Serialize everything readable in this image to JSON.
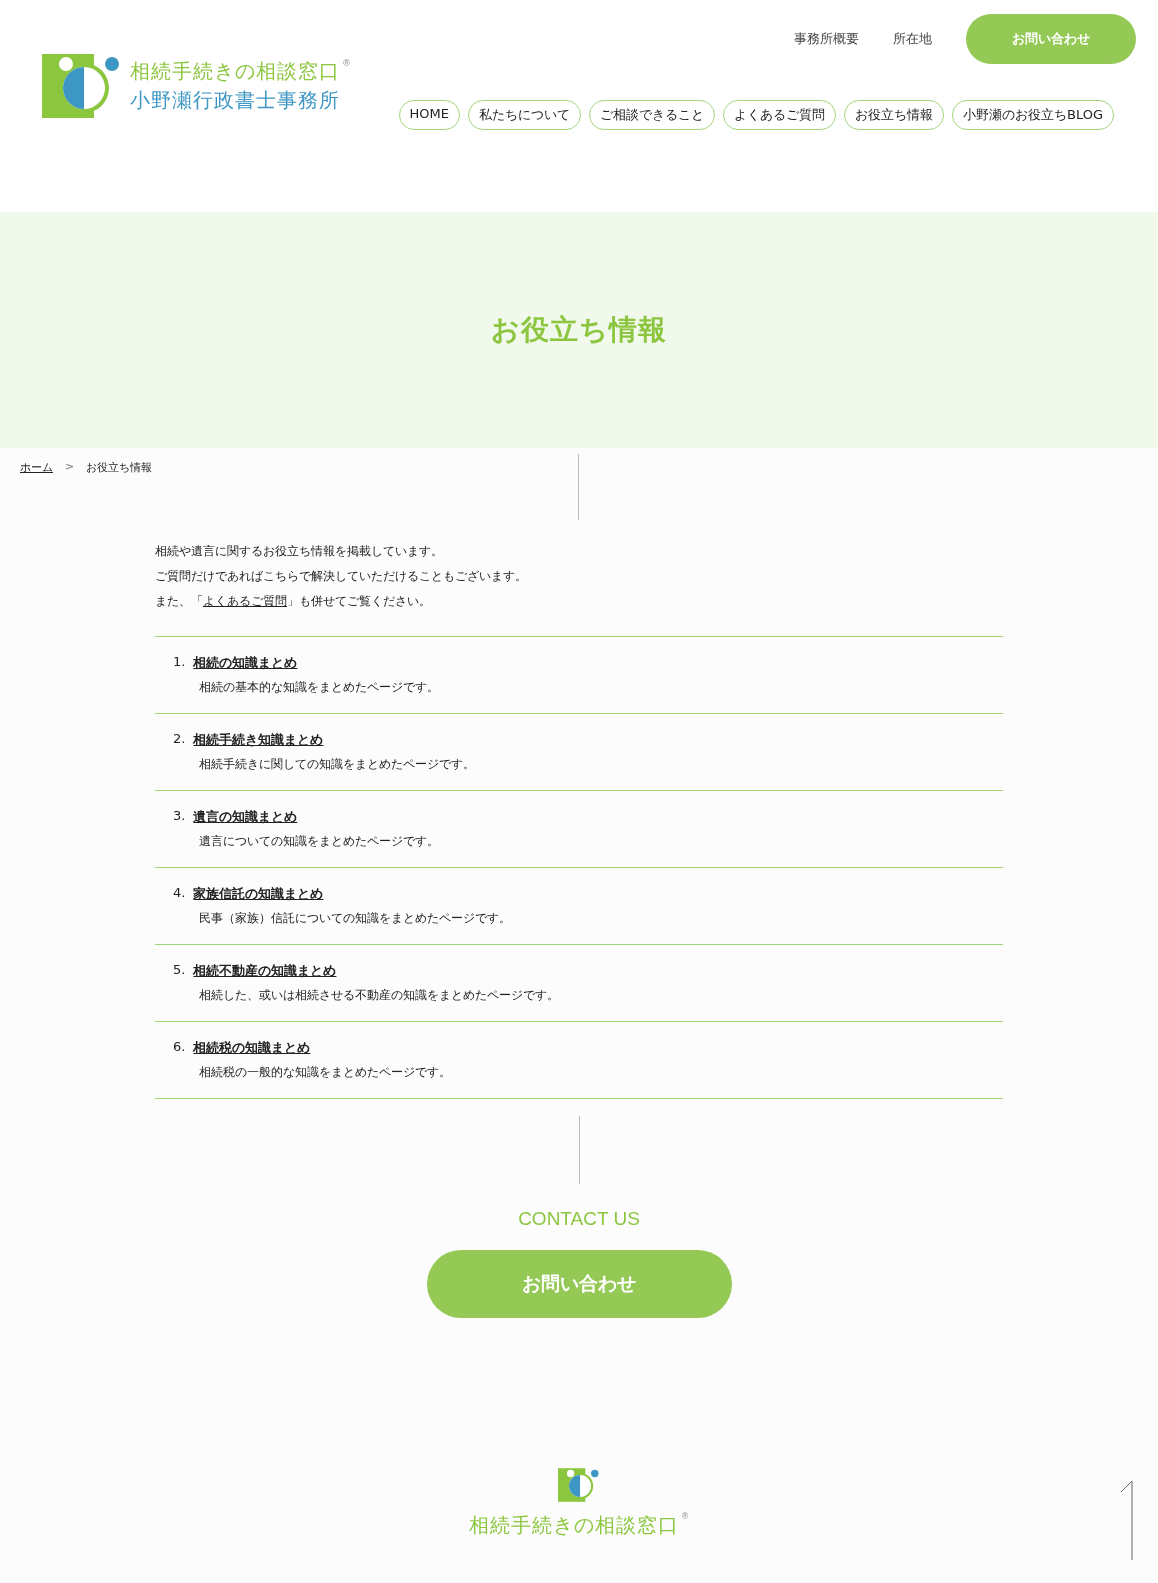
{
  "header": {
    "logo": {
      "line1": "相続手続きの相談窓口",
      "registered": "®",
      "line2": "小野瀬行政書士事務所"
    },
    "top_links": [
      "事務所概要",
      "所在地"
    ],
    "contact_button": "お問い合わせ",
    "nav": [
      "HOME",
      "私たちについて",
      "ご相談できること",
      "よくあるご質問",
      "お役立ち情報",
      "小野瀬のお役立ちBLOG"
    ]
  },
  "hero": {
    "title": "お役立ち情報"
  },
  "breadcrumb": {
    "home": "ホーム",
    "separator": ">",
    "current": "お役立ち情報"
  },
  "intro": {
    "lines": [
      "相続や遺言に関するお役立ち情報を掲載しています。",
      "ご質問だけであればこちらで解決していただけることもございます。"
    ],
    "last": {
      "before": "また、「",
      "link": "よくあるご質問",
      "after": "」も併せてご覧ください。"
    }
  },
  "items": [
    {
      "number": "1.",
      "title": "相続の知識まとめ",
      "description": "相続の基本的な知識をまとめたページです。"
    },
    {
      "number": "2.",
      "title": "相続手続き知識まとめ",
      "description": "相続手続きに関しての知識をまとめたページです。"
    },
    {
      "number": "3.",
      "title": "遺言の知識まとめ",
      "description": "遺言についての知識をまとめたページです。"
    },
    {
      "number": "4.",
      "title": "家族信託の知識まとめ",
      "description": "民事（家族）信託についての知識をまとめたページです。"
    },
    {
      "number": "5.",
      "title": "相続不動産の知識まとめ",
      "description": "相続した、或いは相続させる不動産の知識をまとめたページです。"
    },
    {
      "number": "6.",
      "title": "相続税の知識まとめ",
      "description": "相続税の一般的な知識をまとめたページです。"
    }
  ],
  "contact": {
    "heading": "CONTACT US",
    "button": "お問い合わせ"
  },
  "footer": {
    "logo": {
      "line1": "相続手続きの相談窓口",
      "registered": "®"
    }
  }
}
